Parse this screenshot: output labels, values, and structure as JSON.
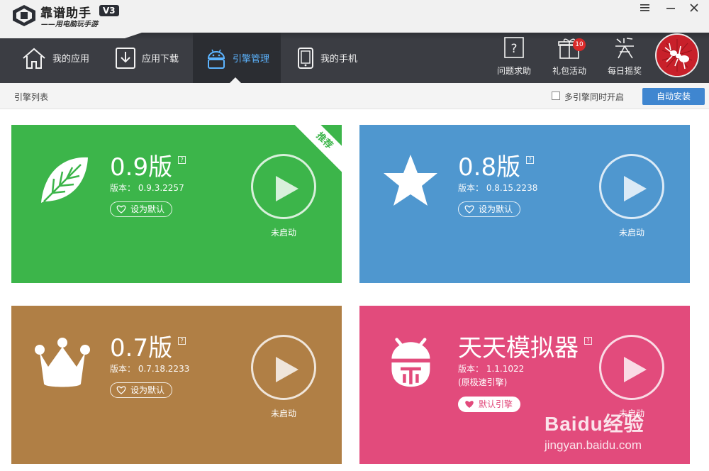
{
  "app": {
    "name": "靠谱助手",
    "version_badge": "V3",
    "slogan": "——用电脑玩手游"
  },
  "nav": {
    "items": [
      {
        "label": "我的应用",
        "icon": "home-icon"
      },
      {
        "label": "应用下载",
        "icon": "download-icon"
      },
      {
        "label": "引擎管理",
        "icon": "android-icon",
        "active": true
      },
      {
        "label": "我的手机",
        "icon": "phone-icon"
      }
    ],
    "tools": [
      {
        "label": "问题求助",
        "icon": "help-icon"
      },
      {
        "label": "礼包活动",
        "icon": "gift-icon",
        "badge": "10"
      },
      {
        "label": "每日摇奖",
        "icon": "lottery-icon"
      }
    ]
  },
  "subbar": {
    "title": "引擎列表",
    "multi_engine_label": "多引擎同时开启",
    "multi_engine_checked": false,
    "auto_install_label": "自动安装"
  },
  "engines": [
    {
      "name": "0.9版",
      "version": "版本： 0.9.3.2257",
      "default_label": "设为默认",
      "status": "未启动",
      "ribbon": "推荐",
      "color": "#3cb54a",
      "icon": "leaf-icon"
    },
    {
      "name": "0.8版",
      "version": "版本： 0.8.15.2238",
      "default_label": "设为默认",
      "status": "未启动",
      "color": "#4f97cf",
      "icon": "star-icon"
    },
    {
      "name": "0.7版",
      "version": "版本： 0.7.18.2233",
      "default_label": "设为默认",
      "status": "未启动",
      "color": "#b07f45",
      "icon": "crown-icon"
    },
    {
      "name": "天天模拟器",
      "version": "版本： 1.1.1022",
      "note": "(原极速引擎)",
      "default_label": "默认引擎",
      "status": "未启动",
      "color": "#e24b7c",
      "icon": "android-bug-icon"
    }
  ],
  "help_mark": "?",
  "watermark": {
    "main": "Baidu经验",
    "sub": "jingyan.baidu.com"
  }
}
